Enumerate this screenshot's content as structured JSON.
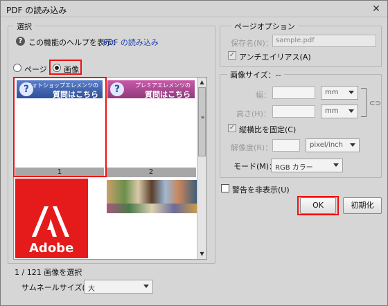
{
  "window": {
    "title": "PDF の読み込み",
    "close": "✕"
  },
  "select_group": {
    "title": "選択",
    "help_prefix": "この機能のヘルプを表示：",
    "help_link": "PDF の読み込み",
    "radio_page": "ページ",
    "radio_image": "画像",
    "selected_mode": "画像",
    "thumbnails": [
      {
        "label": "1",
        "banner_small": "フォトショップエレメンツの",
        "banner_big": "質問はこちら",
        "selected": true
      },
      {
        "label": "2",
        "banner_small": "プレミアエレメンツの",
        "banner_big": "質問はこちら",
        "selected": false
      }
    ],
    "adobe_text": "Adobe",
    "selection_status": "1 / 121 画像を選択",
    "thumbnail_size_label": "サムネールサイズ(T)：",
    "thumbnail_size_value": "大"
  },
  "page_options": {
    "title": "ページオプション",
    "name_label": "保存名(N)：",
    "name_value": "sample.pdf",
    "antialias_label": "アンチエイリアス(A)",
    "antialias_checked": true
  },
  "image_size": {
    "title": "画像サイズ：--",
    "width_label": "幅：",
    "height_label": "高さ(H)：",
    "unit_mm": "mm",
    "constrain_label": "縦横比を固定(C)",
    "constrain_checked": true,
    "resolution_label": "解像度(R)：",
    "resolution_unit": "pixel/inch",
    "mode_label": "モード(M)：",
    "mode_value": "RGB カラー"
  },
  "suppress_warnings_label": "警告を非表示(U)",
  "buttons": {
    "ok": "OK",
    "reset": "初期化"
  },
  "colors": {
    "highlight": "#e11111",
    "link": "#1a3fb7"
  },
  "icons": {
    "help": "help-icon",
    "close": "close-icon",
    "chain": "link-chain-icon"
  }
}
